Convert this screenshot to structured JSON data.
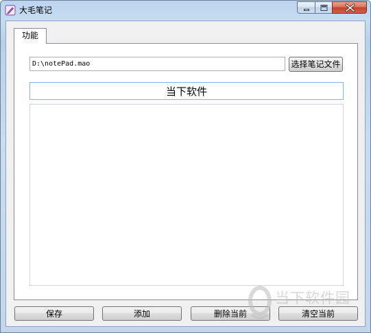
{
  "window": {
    "title": "大毛笔记"
  },
  "tabs": [
    {
      "label": "功能"
    }
  ],
  "file": {
    "path": "D:\\notePad.mao",
    "choose_label": "选择笔记文件"
  },
  "note": {
    "title": "当下软件",
    "content": ""
  },
  "actions": {
    "save_label": "保存",
    "add_label": "添加",
    "delete_label": "删除当前",
    "clear_label": "清空当前"
  },
  "watermark": {
    "text": "当下软件园"
  },
  "icons": {
    "app": "notepad-icon",
    "minimize": "minimize-icon",
    "maximize": "maximize-icon",
    "close": "close-icon"
  },
  "colors": {
    "titlebar": "#c3d6ec",
    "close_button": "#c3432a",
    "focus_border": "#7eb4ea"
  }
}
